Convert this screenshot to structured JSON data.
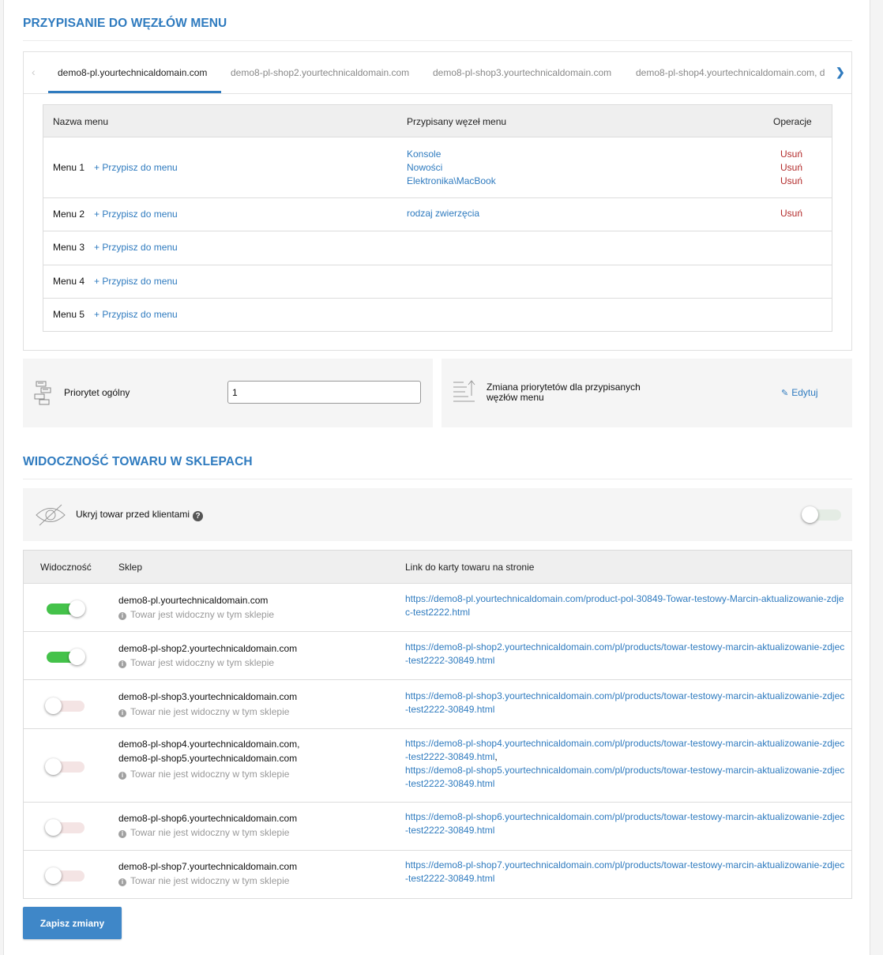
{
  "menu_section": {
    "title": "PRZYPISANIE DO WĘZŁÓW MENU",
    "tabs": [
      {
        "label": "demo8-pl.yourtechnicaldomain.com",
        "active": true
      },
      {
        "label": "demo8-pl-shop2.yourtechnicaldomain.com",
        "active": false
      },
      {
        "label": "demo8-pl-shop3.yourtechnicaldomain.com",
        "active": false
      },
      {
        "label": "demo8-pl-shop4.yourtechnicaldomain.com, d",
        "active": false
      }
    ],
    "table": {
      "headers": {
        "name": "Nazwa menu",
        "node": "Przypisany węzeł menu",
        "ops": "Operacje"
      },
      "add_label": "+ Przypisz do menu",
      "delete_label": "Usuń",
      "rows": [
        {
          "name": "Menu 1",
          "nodes": [
            "Konsole",
            "Nowości",
            "Elektronika\\MacBook"
          ]
        },
        {
          "name": "Menu 2",
          "nodes": [
            "rodzaj zwierzęcia"
          ]
        },
        {
          "name": "Menu 3",
          "nodes": []
        },
        {
          "name": "Menu 4",
          "nodes": []
        },
        {
          "name": "Menu 5",
          "nodes": []
        }
      ]
    }
  },
  "priority": {
    "label": "Priorytet ogólny",
    "value": "1",
    "change_label_line1": "Zmiana priorytetów dla przypisanych",
    "change_label_line2": "węzłów menu",
    "edit_label": "Edytuj"
  },
  "visibility_section": {
    "title": "WIDOCZNOŚĆ TOWARU W SKLEPACH",
    "hide_label": "Ukryj towar przed klientami",
    "hide_help": "?",
    "hide_enabled": false,
    "headers": {
      "visibility": "Widoczność",
      "shop": "Sklep",
      "link": "Link do karty towaru na stronie"
    },
    "rows": [
      {
        "visible": true,
        "shops": [
          "demo8-pl.yourtechnicaldomain.com"
        ],
        "status": "Towar jest widoczny w tym sklepie",
        "links": [
          "https://demo8-pl.yourtechnicaldomain.com/product-pol-30849-Towar-testowy-Marcin-aktualizowanie-zdjec-test2222.html"
        ]
      },
      {
        "visible": true,
        "shops": [
          "demo8-pl-shop2.yourtechnicaldomain.com"
        ],
        "status": "Towar jest widoczny w tym sklepie",
        "links": [
          "https://demo8-pl-shop2.yourtechnicaldomain.com/pl/products/towar-testowy-marcin-aktualizowanie-zdjec-test2222-30849.html"
        ]
      },
      {
        "visible": false,
        "shops": [
          "demo8-pl-shop3.yourtechnicaldomain.com"
        ],
        "status": "Towar nie jest widoczny w tym sklepie",
        "links": [
          "https://demo8-pl-shop3.yourtechnicaldomain.com/pl/products/towar-testowy-marcin-aktualizowanie-zdjec-test2222-30849.html"
        ]
      },
      {
        "visible": false,
        "shops": [
          "demo8-pl-shop4.yourtechnicaldomain.com,",
          "demo8-pl-shop5.yourtechnicaldomain.com"
        ],
        "status": "Towar nie jest widoczny w tym sklepie",
        "links": [
          "https://demo8-pl-shop4.yourtechnicaldomain.com/pl/products/towar-testowy-marcin-aktualizowanie-zdjec-test2222-30849.html",
          "https://demo8-pl-shop5.yourtechnicaldomain.com/pl/products/towar-testowy-marcin-aktualizowanie-zdjec-test2222-30849.html"
        ]
      },
      {
        "visible": false,
        "shops": [
          "demo8-pl-shop6.yourtechnicaldomain.com"
        ],
        "status": "Towar nie jest widoczny w tym sklepie",
        "links": [
          "https://demo8-pl-shop6.yourtechnicaldomain.com/pl/products/towar-testowy-marcin-aktualizowanie-zdjec-test2222-30849.html"
        ]
      },
      {
        "visible": false,
        "shops": [
          "demo8-pl-shop7.yourtechnicaldomain.com"
        ],
        "status": "Towar nie jest widoczny w tym sklepie",
        "links": [
          "https://demo8-pl-shop7.yourtechnicaldomain.com/pl/products/towar-testowy-marcin-aktualizowanie-zdjec-test2222-30849.html"
        ]
      }
    ]
  },
  "save_label": "Zapisz zmiany",
  "colors": {
    "accent": "#2f7bbf",
    "delete": "#b22a2a",
    "toggle_on": "#44c24a",
    "button": "#3f87c8"
  }
}
